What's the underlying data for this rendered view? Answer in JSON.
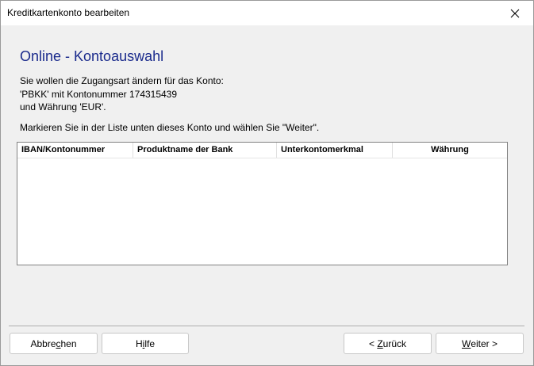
{
  "window": {
    "title": "Kreditkartenkonto bearbeiten"
  },
  "page": {
    "heading": "Online - Kontoauswahl",
    "line1": "Sie wollen die Zugangsart ändern für das Konto:",
    "line2": "'PBKK' mit Kontonummer 174315439",
    "line3": "und Währung 'EUR'.",
    "instruction": "Markieren Sie in der Liste unten dieses Konto und wählen Sie \"Weiter\"."
  },
  "list": {
    "columns": [
      {
        "label": "IBAN/Kontonummer"
      },
      {
        "label": "Produktname der Bank"
      },
      {
        "label": "Unterkontomerkmal"
      },
      {
        "label": "Währung"
      }
    ],
    "rows": []
  },
  "buttons": {
    "cancel": {
      "pre": "Abbre",
      "key": "c",
      "post": "hen"
    },
    "help": {
      "pre": "H",
      "key": "i",
      "post": "lfe"
    },
    "back": {
      "pre": "< ",
      "key": "Z",
      "post": "urück"
    },
    "next": {
      "pre": "",
      "key": "W",
      "post": "eiter >"
    }
  },
  "icons": {
    "close": "close-icon"
  },
  "colors": {
    "heading": "#1a2a8c",
    "dialog_bg": "#f0f0f0"
  }
}
